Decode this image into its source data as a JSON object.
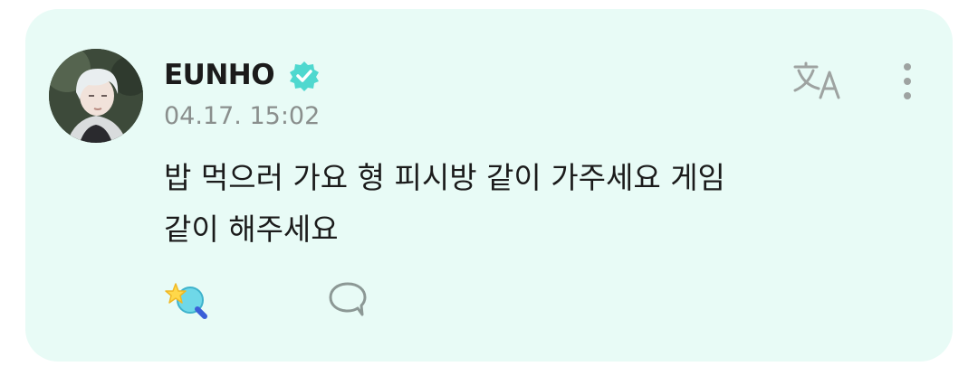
{
  "post": {
    "author": "EUNHO",
    "timestamp": "04.17. 15:02",
    "text_lines": [
      "밥 먹으러 가요 형 피시방 같이 가주세요 게임",
      "같이 해주세요"
    ]
  },
  "icons": {
    "avatar": "avatar-image",
    "verified": "verified-badge-icon",
    "translate": "translate-icon",
    "more": "more-vertical-icon",
    "reaction": "star-reaction-icon",
    "comment": "comment-bubble-icon"
  },
  "colors": {
    "card_background": "#e8fbf6",
    "verified_badge": "#4fd8cf",
    "text_primary": "#1b1b1b",
    "text_secondary": "#8a8f8d",
    "icon_gray": "#9ea3a1"
  }
}
